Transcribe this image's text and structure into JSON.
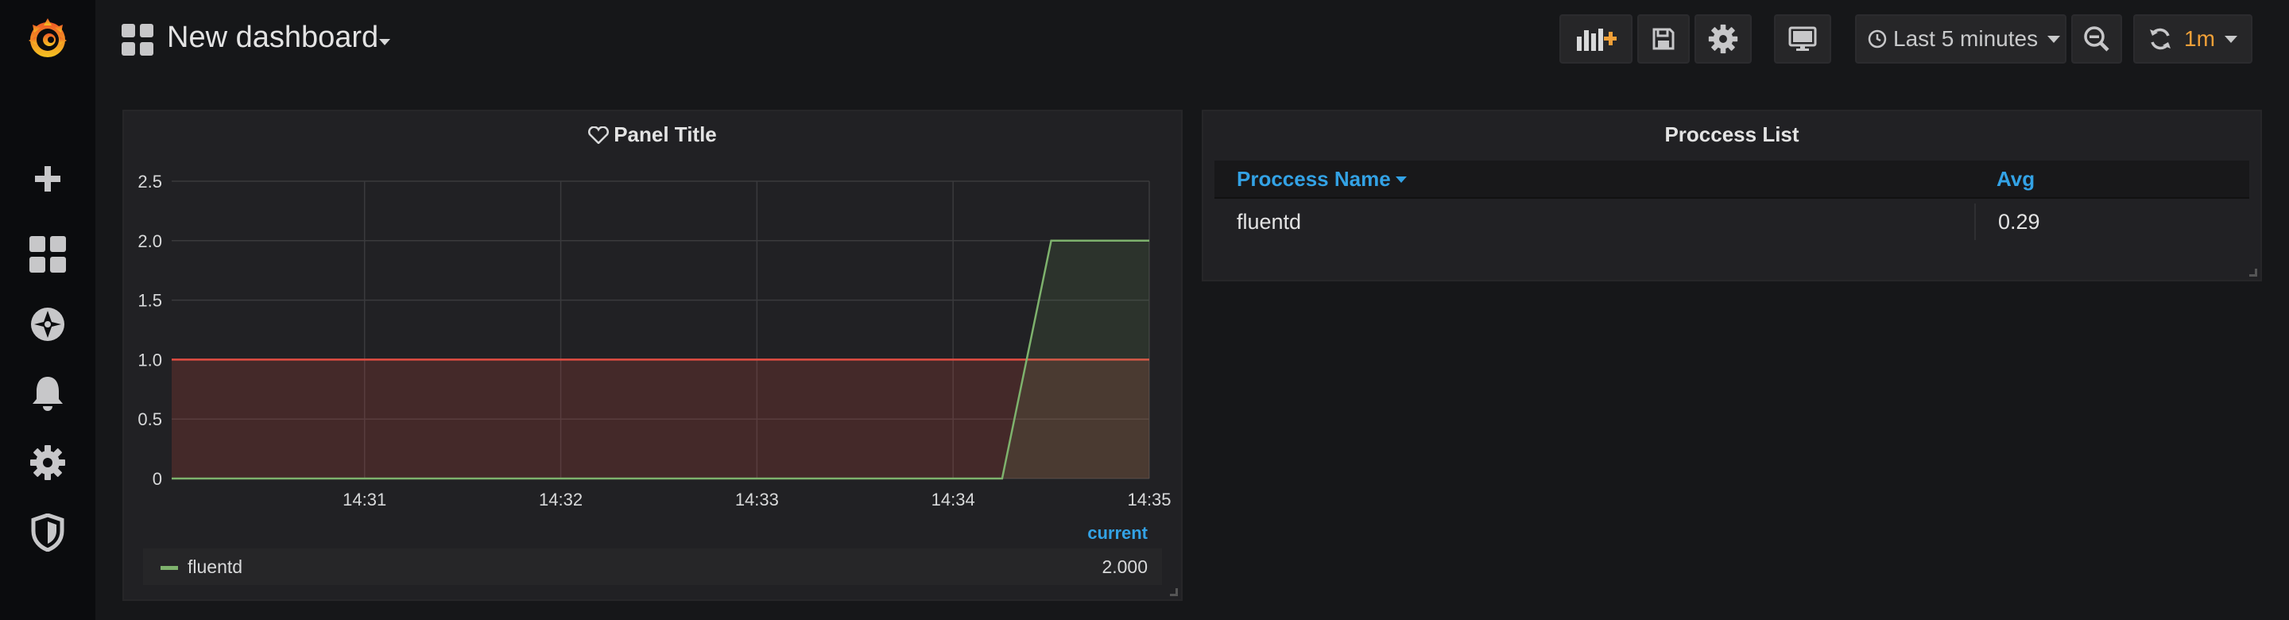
{
  "navbar": {
    "title": "New dashboard",
    "time_range": "Last 5 minutes",
    "refresh_interval": "1m"
  },
  "graph_panel": {
    "title": "Panel Title",
    "legend_header": "current",
    "legend": [
      {
        "name": "fluentd",
        "current": "2.000",
        "color": "#7eb26d"
      }
    ]
  },
  "table_panel": {
    "title": "Proccess List",
    "columns": [
      "Proccess Name",
      "Avg"
    ],
    "rows": [
      [
        "fluentd",
        "0.29"
      ]
    ]
  },
  "colors": {
    "accent_link": "#33a2e5",
    "refresh_orange": "#f0a038",
    "series_green": "#7eb26d",
    "threshold_red": "#e24d42"
  },
  "chart_data": {
    "type": "line",
    "x": [
      "14:30:01",
      "14:30:30",
      "14:31",
      "14:31:30",
      "14:32",
      "14:32:30",
      "14:33",
      "14:33:30",
      "14:34",
      "14:34:15",
      "14:34:30",
      "14:35"
    ],
    "xticks": [
      "14:31",
      "14:32",
      "14:33",
      "14:34",
      "14:35"
    ],
    "yticks": [
      "0",
      "0.5",
      "1.0",
      "1.5",
      "2.0",
      "2.5"
    ],
    "ylim": [
      0,
      2.5
    ],
    "series": [
      {
        "name": "fluentd",
        "values": [
          0,
          0,
          0,
          0,
          0,
          0,
          0,
          0,
          0,
          0,
          2,
          2
        ]
      }
    ],
    "threshold": 1.0,
    "grid": true
  }
}
